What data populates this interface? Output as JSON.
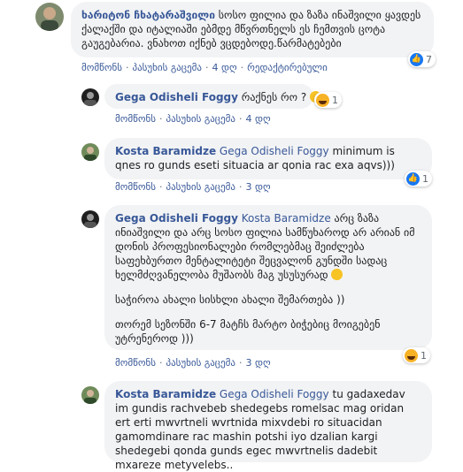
{
  "comments": [
    {
      "author": "ხარიტონ ჩხატარაშვილი",
      "tag": "",
      "text": "სოსო ფილია და ზაზა ინაშვილი ყავდეს ქალაქში და იტალიაში ებმდე მწვრთნელს ეს ჩემთვის ცოტა გაუგებარია. ვნახოთ იქნებ ვცდებოდე.წარმატებები",
      "actions": {
        "like": "მომწონს",
        "reply": "პასუხის გაცემა",
        "time": "4 დღ",
        "edited": "რედაქტირებული"
      },
      "reaction": {
        "type": "like",
        "count": "7"
      }
    },
    {
      "author": "Gega Odisheli Foggy",
      "tag": "",
      "text": "რაქნეს რო ?",
      "actions": {
        "like": "მომწონს",
        "reply": "პასუხის გაცემა",
        "time": "4 დღ"
      },
      "reaction": {
        "type": "haha",
        "count": "1"
      }
    },
    {
      "author": "Kosta Baramidze",
      "tag": "Gega Odisheli Foggy",
      "text": "minimum is qnes ro gunds eseti situacia ar qonia rac exa aqvs)))",
      "actions": {
        "like": "მომწონს",
        "reply": "პასუხის გაცემა",
        "time": "3 დღ"
      },
      "reaction": {
        "type": "like",
        "count": "1"
      }
    },
    {
      "author": "Gega Odisheli Foggy",
      "tag": "Kosta Baramidze",
      "text": "არც ზაზა ინიაშვილი და არც სოსო ფილია სამწუხაროდ არ არიან იმ დონის პროფესიონალები რომლებმაც შეიძლება საფეხბურთო მენტალიტეტი შეცვალონ გუნდში სადაც ხელმძღვანელობა მუშაობს მაგ უსუსურად",
      "text2": "საჭიროა ახალი სისხლი ახალი შემართება ))",
      "text3": "თორემ სეზონში 6-7 მატჩს მარტო ბიჭებიც მოიგებენ უტრენეროდ )))",
      "actions": {
        "like": "მომწონს",
        "reply": "პასუხის გაცემა",
        "time": "3 დღ"
      },
      "reaction": {
        "type": "haha",
        "count": "1"
      }
    },
    {
      "author": "Kosta Baramidze",
      "tag": "Gega Odisheli Foggy",
      "text": "tu gadaxedav im gundis rachvebeb shedegebs romelsac mag oridan ert erti mwvrtneli wvrtnida mixvdebi ro situacidan gamomdinare rac mashin potshi iyo dzalian kargi shedegebi qonda gunds egec mwvrtnelis dadebit mxareze metyvelebs.."
    }
  ]
}
